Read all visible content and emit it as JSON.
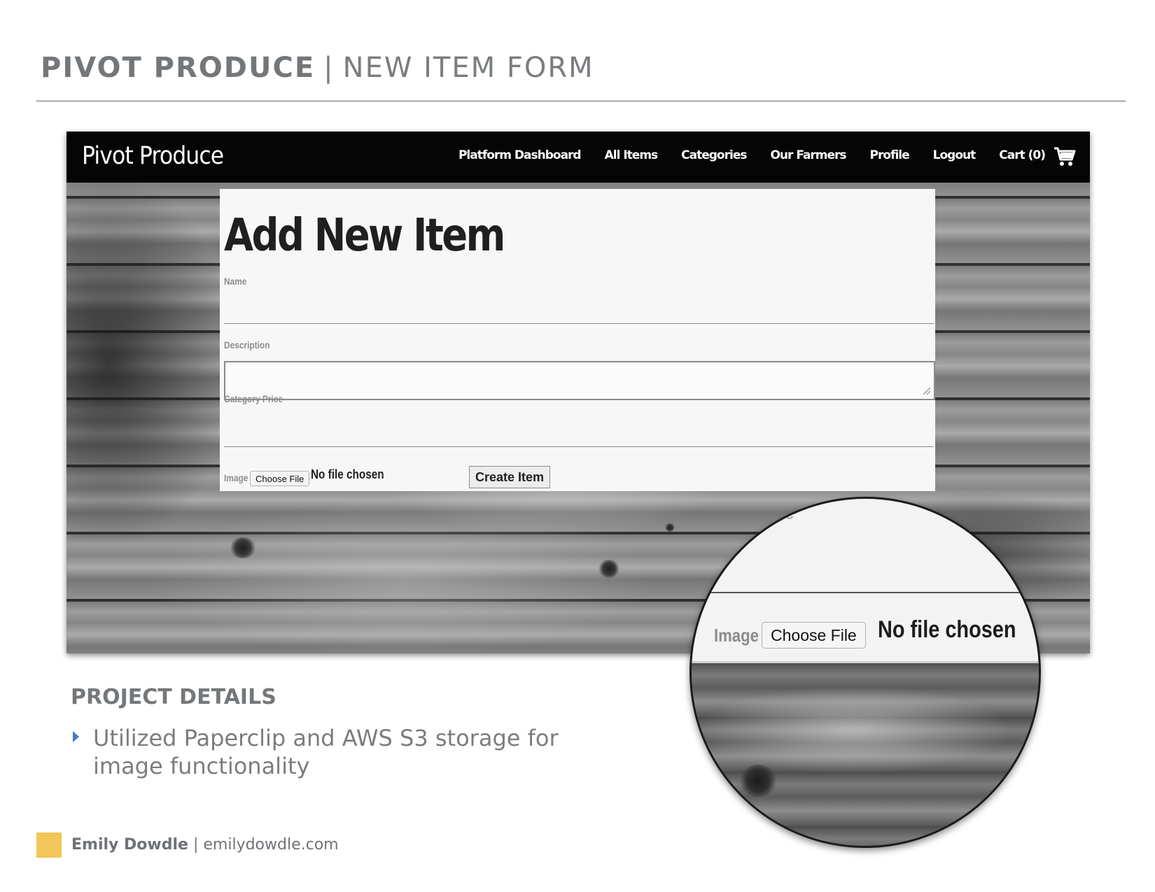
{
  "slide": {
    "title_brand": "PIVOT PRODUCE",
    "title_separator": "|",
    "title_section": "NEW ITEM FORM"
  },
  "screenshot": {
    "nav": {
      "logo": "Pivot Produce",
      "links": [
        "Platform Dashboard",
        "All Items",
        "Categories",
        "Our Farmers",
        "Profile",
        "Logout",
        "Cart (0)"
      ],
      "cart_icon": "shopping-cart-icon"
    },
    "form": {
      "title": "Add New Item",
      "name_label": "Name",
      "name_value": "",
      "description_label": "Description",
      "description_value": "",
      "category_price_label": "Category Price",
      "price_value": "",
      "image_label": "Image",
      "choose_file_label": "Choose File",
      "file_status": "No file chosen",
      "submit_label": "Create Item"
    },
    "magnifier": {
      "price_label_partial": "rice",
      "image_label": "Image",
      "choose_file_label": "Choose File",
      "file_status": "No file chosen"
    }
  },
  "project_details": {
    "heading": "PROJECT DETAILS",
    "bullets": [
      "Utilized Paperclip and AWS S3 storage for image functionality"
    ]
  },
  "footer": {
    "name": "Emily Dowdle",
    "separator": "|",
    "website": "emilydowdle.com",
    "accent_color": "#f1c75a"
  },
  "colors": {
    "nav_background": "#050505",
    "bullet_accent": "#4b7dc0",
    "slide_text": "#7a7d80"
  }
}
